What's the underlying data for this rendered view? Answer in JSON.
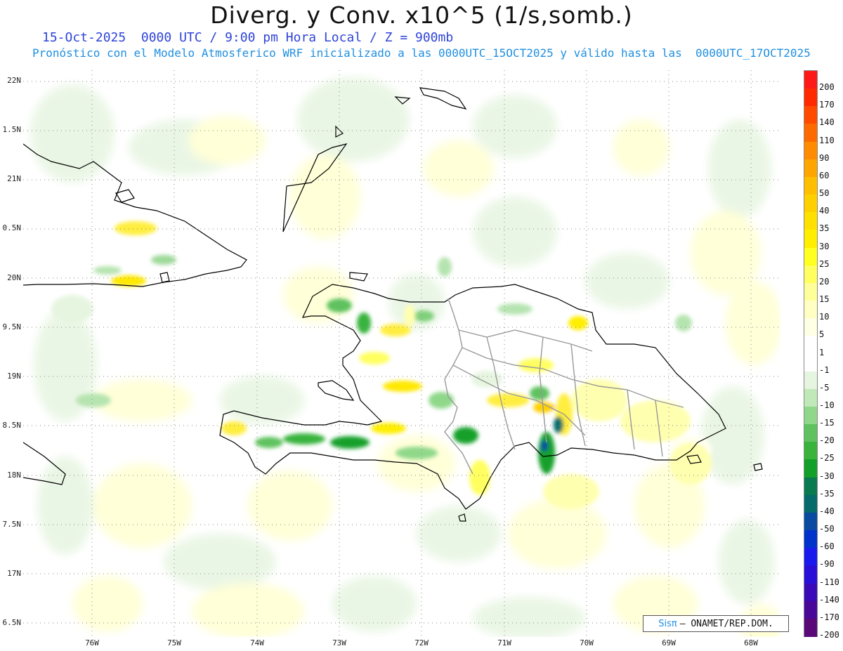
{
  "header": {
    "title": "Diverg. y Conv. x10^5 (1/s,somb.)",
    "line1": "15-Oct-2025  0000 UTC / 9:00 pm Hora Local / Z = 900mb",
    "line2": "Pronóstico con el Modelo Atmosferico WRF inicializado a las 0000UTC_15OCT2025 y válido hasta las  0000UTC_17OCT2025"
  },
  "axes": {
    "lat_labels": [
      "22N",
      "1.5N",
      "21N",
      "0.5N",
      "20N",
      "9.5N",
      "19N",
      "8.5N",
      "18N",
      "7.5N",
      "17N",
      "6.5N"
    ],
    "lon_labels": [
      "76W",
      "75W",
      "74W",
      "73W",
      "72W",
      "71W",
      "70W",
      "69W",
      "68W"
    ]
  },
  "colorbar": {
    "labels": [
      "200",
      "170",
      "140",
      "110",
      "90",
      "60",
      "50",
      "40",
      "35",
      "30",
      "25",
      "20",
      "15",
      "10",
      "5",
      "1",
      "-1",
      "-5",
      "-10",
      "-15",
      "-20",
      "-25",
      "-30",
      "-35",
      "-40",
      "-50",
      "-60",
      "-90",
      "-110",
      "-140",
      "-170",
      "-200"
    ],
    "colors": [
      "#ff1a1a",
      "#ff2a00",
      "#ff4a00",
      "#ff6a00",
      "#ff8c00",
      "#ffa500",
      "#ffbf00",
      "#ffd000",
      "#ffe000",
      "#ffee00",
      "#ffff20",
      "#ffff60",
      "#ffff99",
      "#ffffc4",
      "#ffffe6",
      "#ffffff",
      "#ffffff",
      "#e6f5e0",
      "#c0e8b8",
      "#8fd88a",
      "#5fc25f",
      "#39b33c",
      "#13a02a",
      "#0a7a50",
      "#066b6b",
      "#0a4aa0",
      "#0033cc",
      "#1a1aee",
      "#2a0fd8",
      "#3a0ab8",
      "#4a0898",
      "#5a0878"
    ]
  },
  "credit": {
    "brand": "Sisπ",
    "text": "– ONAMET/REP.DOM."
  }
}
